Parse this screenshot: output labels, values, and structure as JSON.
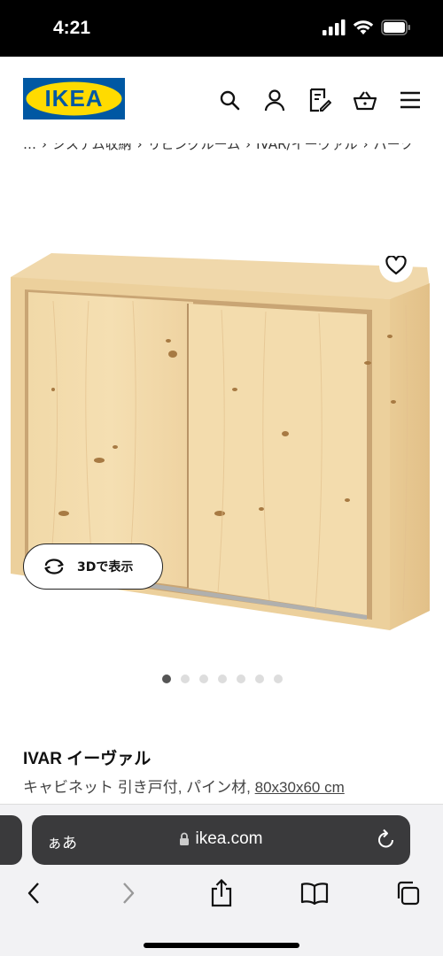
{
  "status_bar": {
    "time": "4:21"
  },
  "header": {
    "logo_text": "IKEA",
    "colors": {
      "logo_blue": "#0058a3",
      "logo_yellow": "#ffdb00"
    },
    "icons": [
      "search-icon",
      "user-icon",
      "shopping-list-icon",
      "cart-icon",
      "menu-icon"
    ]
  },
  "breadcrumb": {
    "items": [
      "…",
      "システム収納",
      "リビングルーム",
      "IVAR/イーヴァル",
      "パーツ"
    ]
  },
  "gallery": {
    "view_3d_label": "3Dで表示",
    "dot_count": 7,
    "active_dot": 1
  },
  "product": {
    "name": "IVAR イーヴァル",
    "description": "キャビネット 引き戸付, パイン材, ",
    "dimensions": "80x30x60 cm"
  },
  "safari": {
    "aa_label": "ぁあ",
    "url": "ikea.com"
  }
}
